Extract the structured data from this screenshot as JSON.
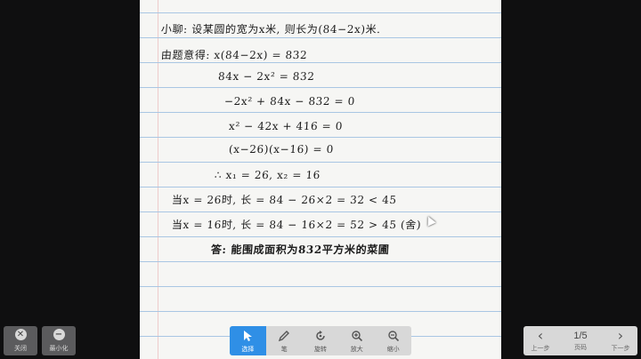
{
  "notes": {
    "lines": [
      "小聊: 设某圆的宽为x米, 则长为(84−2x)米.",
      "由题意得:    x(84−2x) = 832",
      "84x − 2x² = 832",
      "−2x² + 84x − 832 = 0",
      "x² − 42x + 416 = 0",
      "(x−26)(x−16) = 0",
      "∴   x₁ = 26,    x₂ = 16",
      "当x = 26时,  长 = 84 − 26×2 = 32  < 45",
      "当x = 16时,  长 = 84 − 16×2 = 52  > 45  (舍)",
      "答: 能围成面积为832平方米的菜圃"
    ]
  },
  "left_buttons": [
    {
      "label": "关闭",
      "icon": "close-icon",
      "glyph": "✕"
    },
    {
      "label": "最小化",
      "icon": "minimize-icon",
      "glyph": "−"
    }
  ],
  "toolbar": {
    "tools": [
      {
        "label": "选择",
        "icon": "cursor-icon"
      },
      {
        "label": "笔",
        "icon": "pen-icon"
      },
      {
        "label": "旋转",
        "icon": "rotate-icon"
      },
      {
        "label": "放大",
        "icon": "zoom-in-icon"
      },
      {
        "label": "缩小",
        "icon": "zoom-out-icon"
      }
    ],
    "active": "选择",
    "accent": "#2f8fe6"
  },
  "pager": {
    "prev_label": "上一步",
    "next_label": "下一步",
    "page_indicator": "1/5",
    "page_label": "页码"
  }
}
